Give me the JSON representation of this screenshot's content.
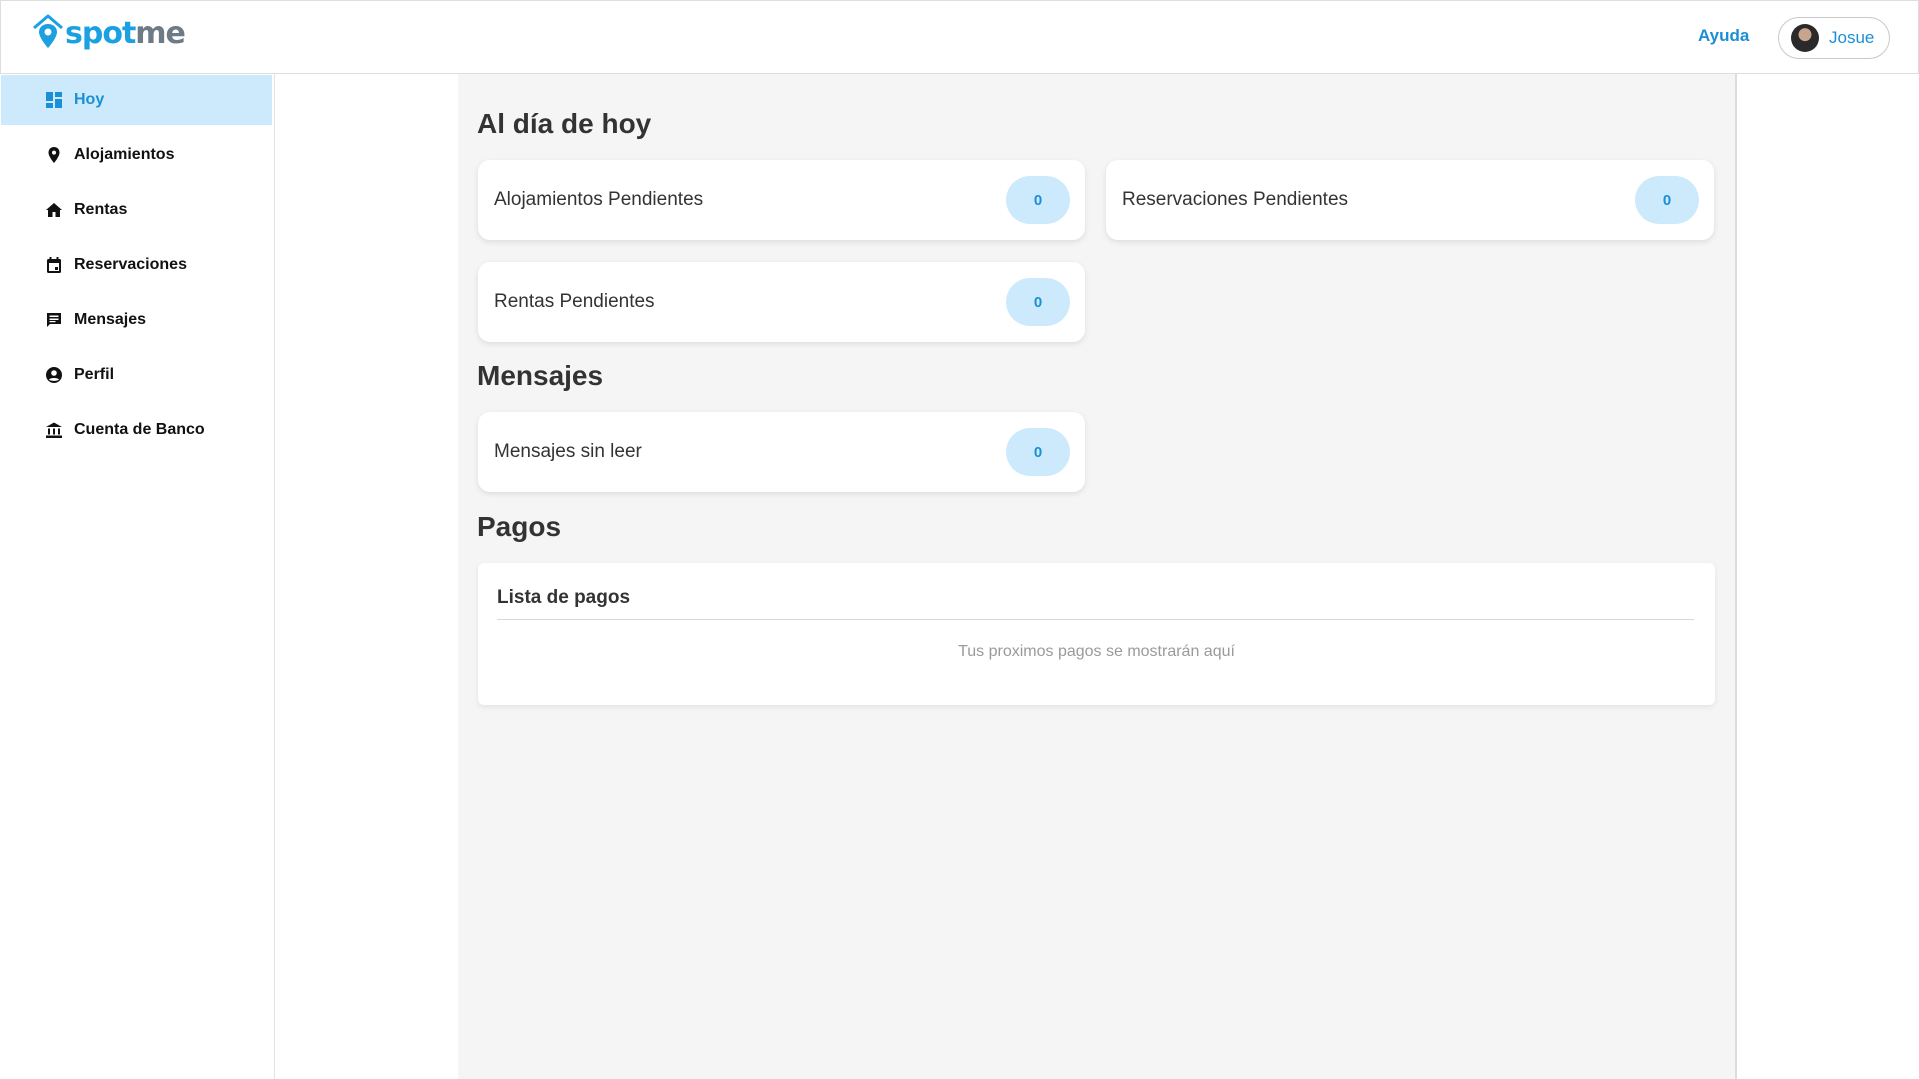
{
  "brand": {
    "logo_part1": "spot",
    "logo_part2": "me",
    "primary_color": "#1ba0e2",
    "link_color": "#1b8fd6",
    "active_bg": "#cdeafc"
  },
  "header": {
    "help_label": "Ayuda",
    "user_name": "Josue"
  },
  "sidebar": {
    "items": [
      {
        "label": "Hoy",
        "icon": "dashboard-icon",
        "active": true
      },
      {
        "label": "Alojamientos",
        "icon": "location-pin-icon",
        "active": false
      },
      {
        "label": "Rentas",
        "icon": "house-icon",
        "active": false
      },
      {
        "label": "Reservaciones",
        "icon": "calendar-icon",
        "active": false
      },
      {
        "label": "Mensajes",
        "icon": "message-icon",
        "active": false
      },
      {
        "label": "Perfil",
        "icon": "account-circle-icon",
        "active": false
      },
      {
        "label": "Cuenta de Banco",
        "icon": "bank-icon",
        "active": false
      }
    ]
  },
  "main": {
    "today_title": "Al día de hoy",
    "today_cards": [
      {
        "label": "Alojamientos Pendientes",
        "count": "0"
      },
      {
        "label": "Reservaciones Pendientes",
        "count": "0"
      },
      {
        "label": "Rentas Pendientes",
        "count": "0"
      }
    ],
    "messages_title": "Mensajes",
    "messages_cards": [
      {
        "label": "Mensajes sin leer",
        "count": "0"
      }
    ],
    "payments_title": "Pagos",
    "payments_list_title": "Lista de pagos",
    "payments_empty": "Tus proximos pagos se mostrarán aquí"
  }
}
